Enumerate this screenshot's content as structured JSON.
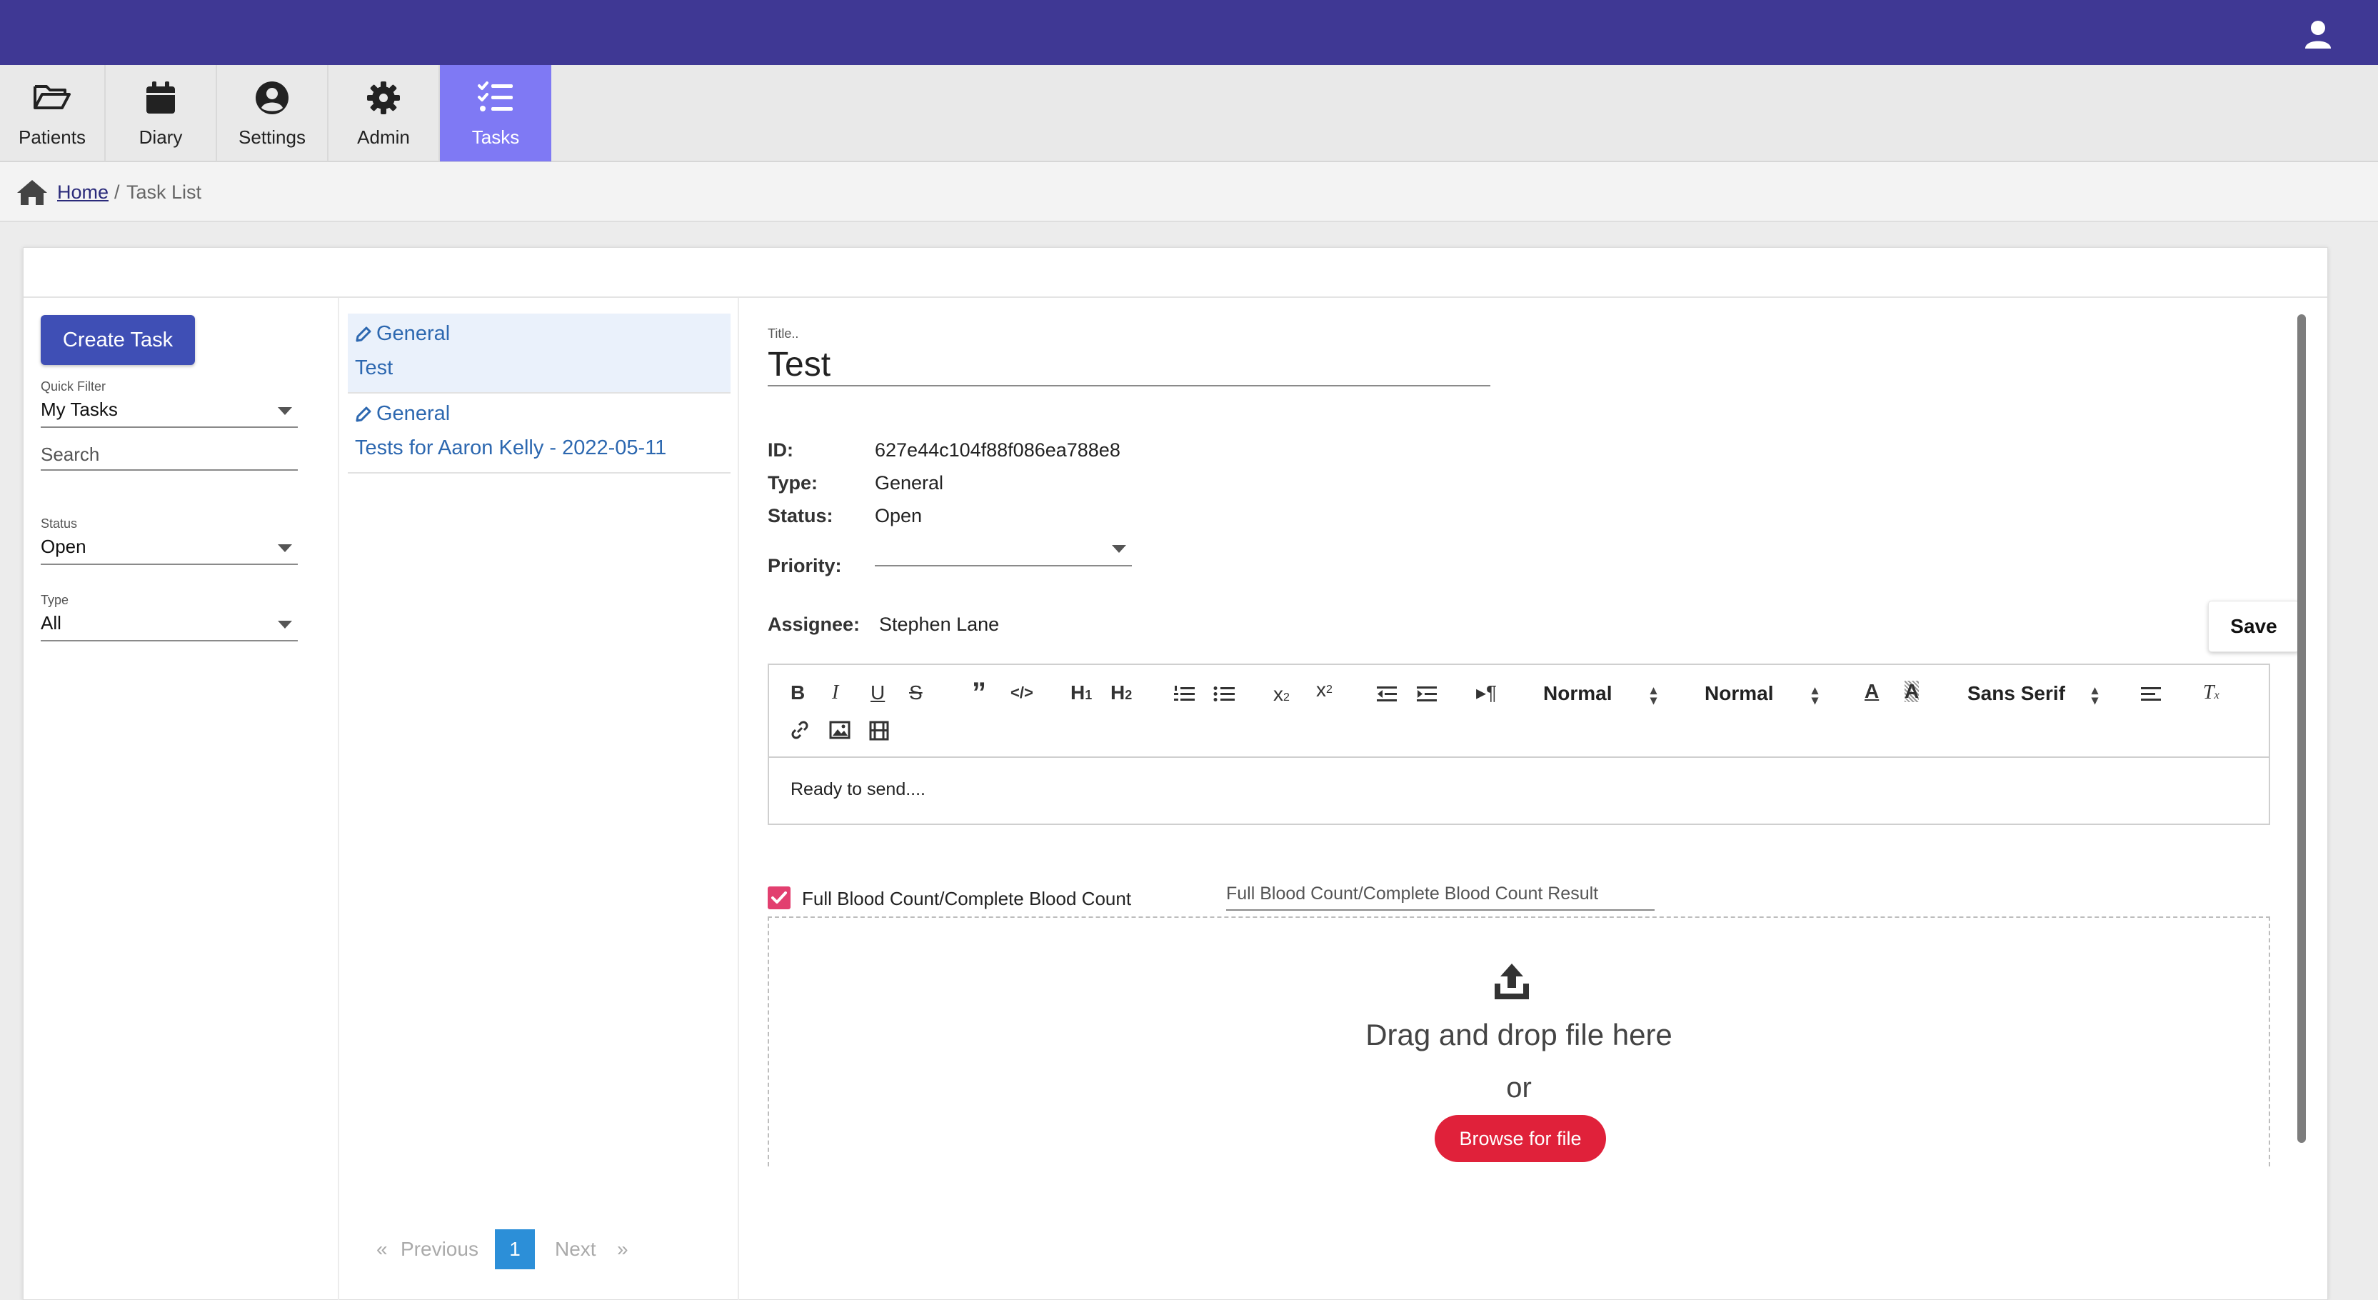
{
  "nav": {
    "items": [
      {
        "label": "Patients",
        "icon": "folder-open-icon"
      },
      {
        "label": "Diary",
        "icon": "calendar-icon"
      },
      {
        "label": "Settings",
        "icon": "user-circle-icon"
      },
      {
        "label": "Admin",
        "icon": "gear-icon"
      },
      {
        "label": "Tasks",
        "icon": "tasks-icon",
        "active": true
      }
    ]
  },
  "breadcrumb": {
    "home": "Home",
    "separator": "/",
    "current": "Task List"
  },
  "filters": {
    "create_label": "Create Task",
    "quick_filter": {
      "label": "Quick Filter",
      "value": "My Tasks"
    },
    "search_placeholder": "Search",
    "status": {
      "label": "Status",
      "value": "Open"
    },
    "type": {
      "label": "Type",
      "value": "All"
    }
  },
  "tasks": [
    {
      "type": "General",
      "name": "Test",
      "selected": true
    },
    {
      "type": "General",
      "name": "Tests for Aaron Kelly - 2022-05-11",
      "selected": false
    }
  ],
  "pager": {
    "prev_symbol": "«",
    "prev": "Previous",
    "current": "1",
    "next": "Next",
    "next_symbol": "»"
  },
  "detail": {
    "title_label": "Title..",
    "title": "Test",
    "id_label": "ID:",
    "id": "627e44c104f88f086ea788e8",
    "type_label": "Type:",
    "type": "General",
    "status_label": "Status:",
    "status": "Open",
    "priority_label": "Priority:",
    "priority": "",
    "assignee_label": "Assignee:",
    "assignee": "Stephen Lane",
    "save_label": "Save"
  },
  "editor": {
    "header_select": "Normal",
    "size_select": "Normal",
    "font_select": "Sans Serif",
    "body": "Ready to send...."
  },
  "test": {
    "checked": true,
    "label": "Full Blood Count/Complete Blood Count",
    "result_placeholder": "Full Blood Count/Complete Blood Count Result"
  },
  "dropzone": {
    "text": "Drag and drop file here",
    "or": "or",
    "browse_label": "Browse for file"
  },
  "colors": {
    "topbar": "#3f3894",
    "nav_active": "#7f79f4",
    "primary": "#3f4fb5",
    "link": "#2d68b0",
    "checkbox": "#e23f6f",
    "browse": "#e0213a",
    "page_current": "#2c8fd8"
  }
}
